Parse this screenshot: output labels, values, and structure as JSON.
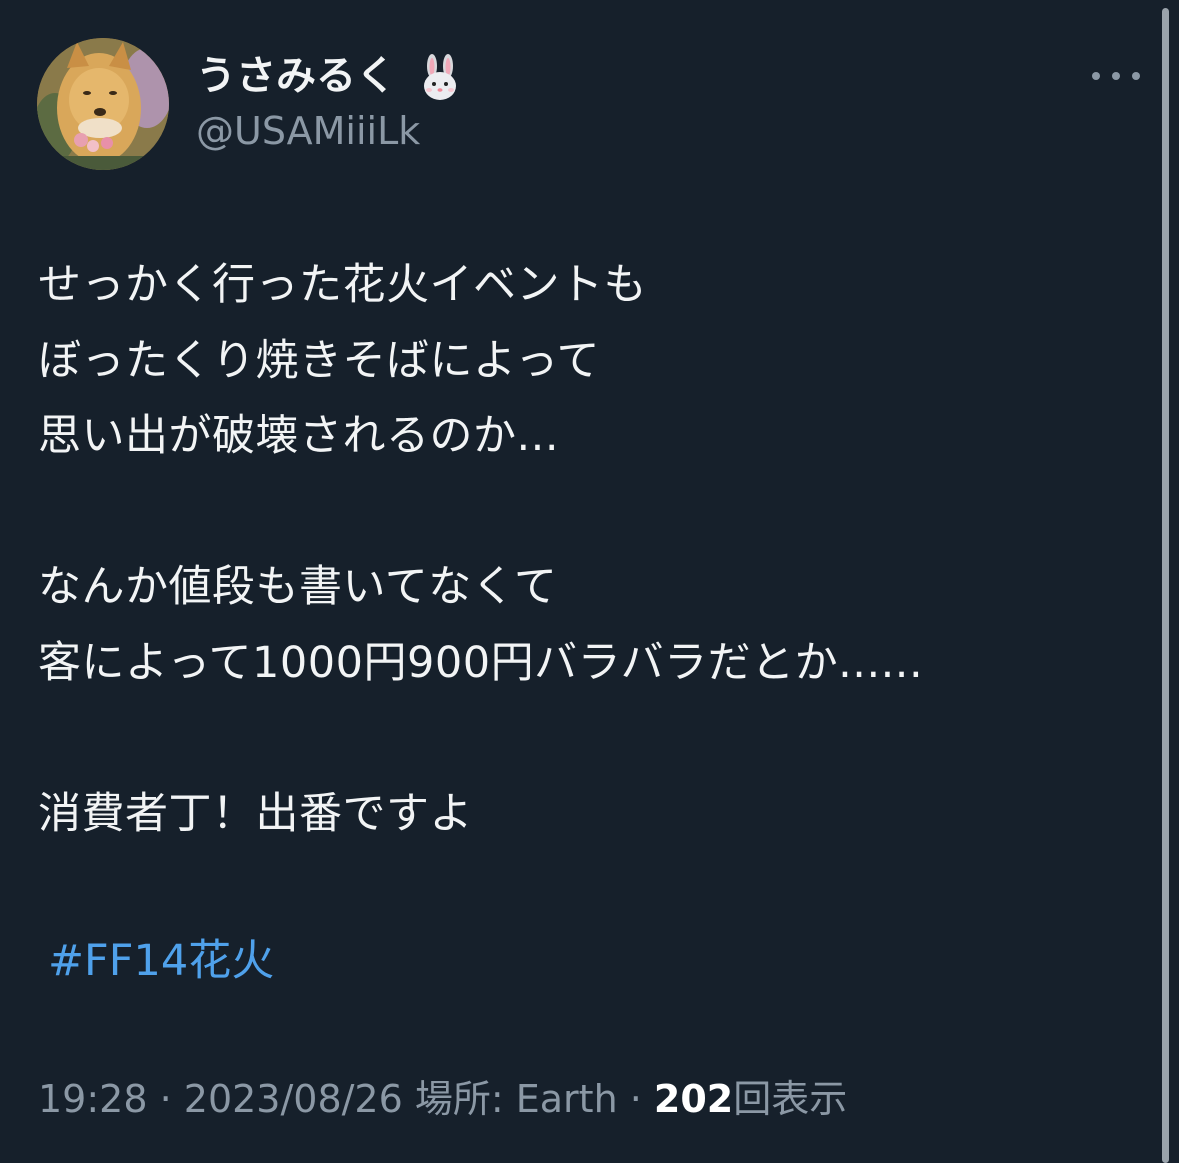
{
  "tweet": {
    "author": {
      "display_name": "うさみるく",
      "name_emoji_icon": "rabbit-face-icon",
      "handle": "@USAMiiiLk",
      "avatar_icon": "dog-avatar"
    },
    "more_icon": "more-horizontal-icon",
    "body_lines": [
      "せっかく行った花火イベントも",
      "ぼったくり焼きそばによって",
      "思い出が破壊されるのか...",
      "",
      "なんか値段も書いてなくて",
      "客によって1000円900円バラバラだとか......",
      "",
      "消費者丁！出番ですよ"
    ],
    "hashtag": "#FF14花火",
    "meta": {
      "time": "19:28",
      "separator1": " · ",
      "date": "2023/08/26",
      "location": " 場所: Earth",
      "separator2": " · ",
      "views_count": "202",
      "views_label": "回表示"
    }
  },
  "colors": {
    "background": "#16202b",
    "text": "#f2f4f5",
    "secondary": "#8b98a5",
    "link": "#4fa1eb"
  }
}
